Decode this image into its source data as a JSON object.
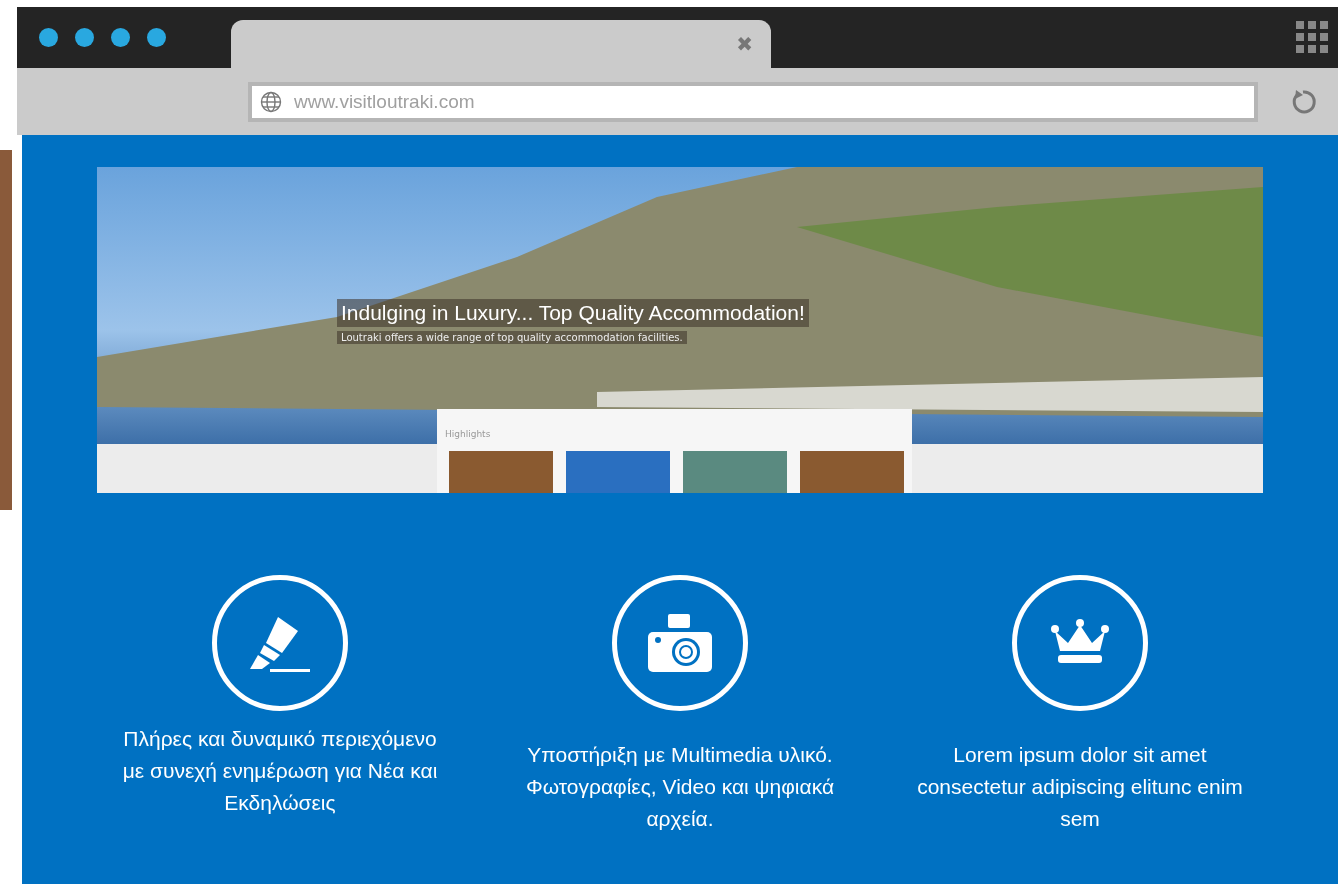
{
  "browser": {
    "tab_close": "✖",
    "url": "www.visitloutraki.com"
  },
  "hero": {
    "title": "Indulging in Luxury... Top Quality Accommodation!",
    "subtitle": "Loutraki offers a wide range of top quality accommodation facilities.",
    "highlights_label": "Highlights"
  },
  "features": [
    {
      "kind": "highlighter",
      "text": "Πλήρες και δυναμικό περιεχόμενο με συνεχή ενημέρωση για Νέα και Εκδηλώσεις"
    },
    {
      "kind": "camera",
      "text": "Υποστήριξη με Multimedia υλικό. Φωτογραφίες, Video και ψηφιακά αρχεία."
    },
    {
      "kind": "crown",
      "text": "Lorem ipsum dolor sit amet consectetur adipiscing elitunc enim sem"
    }
  ]
}
